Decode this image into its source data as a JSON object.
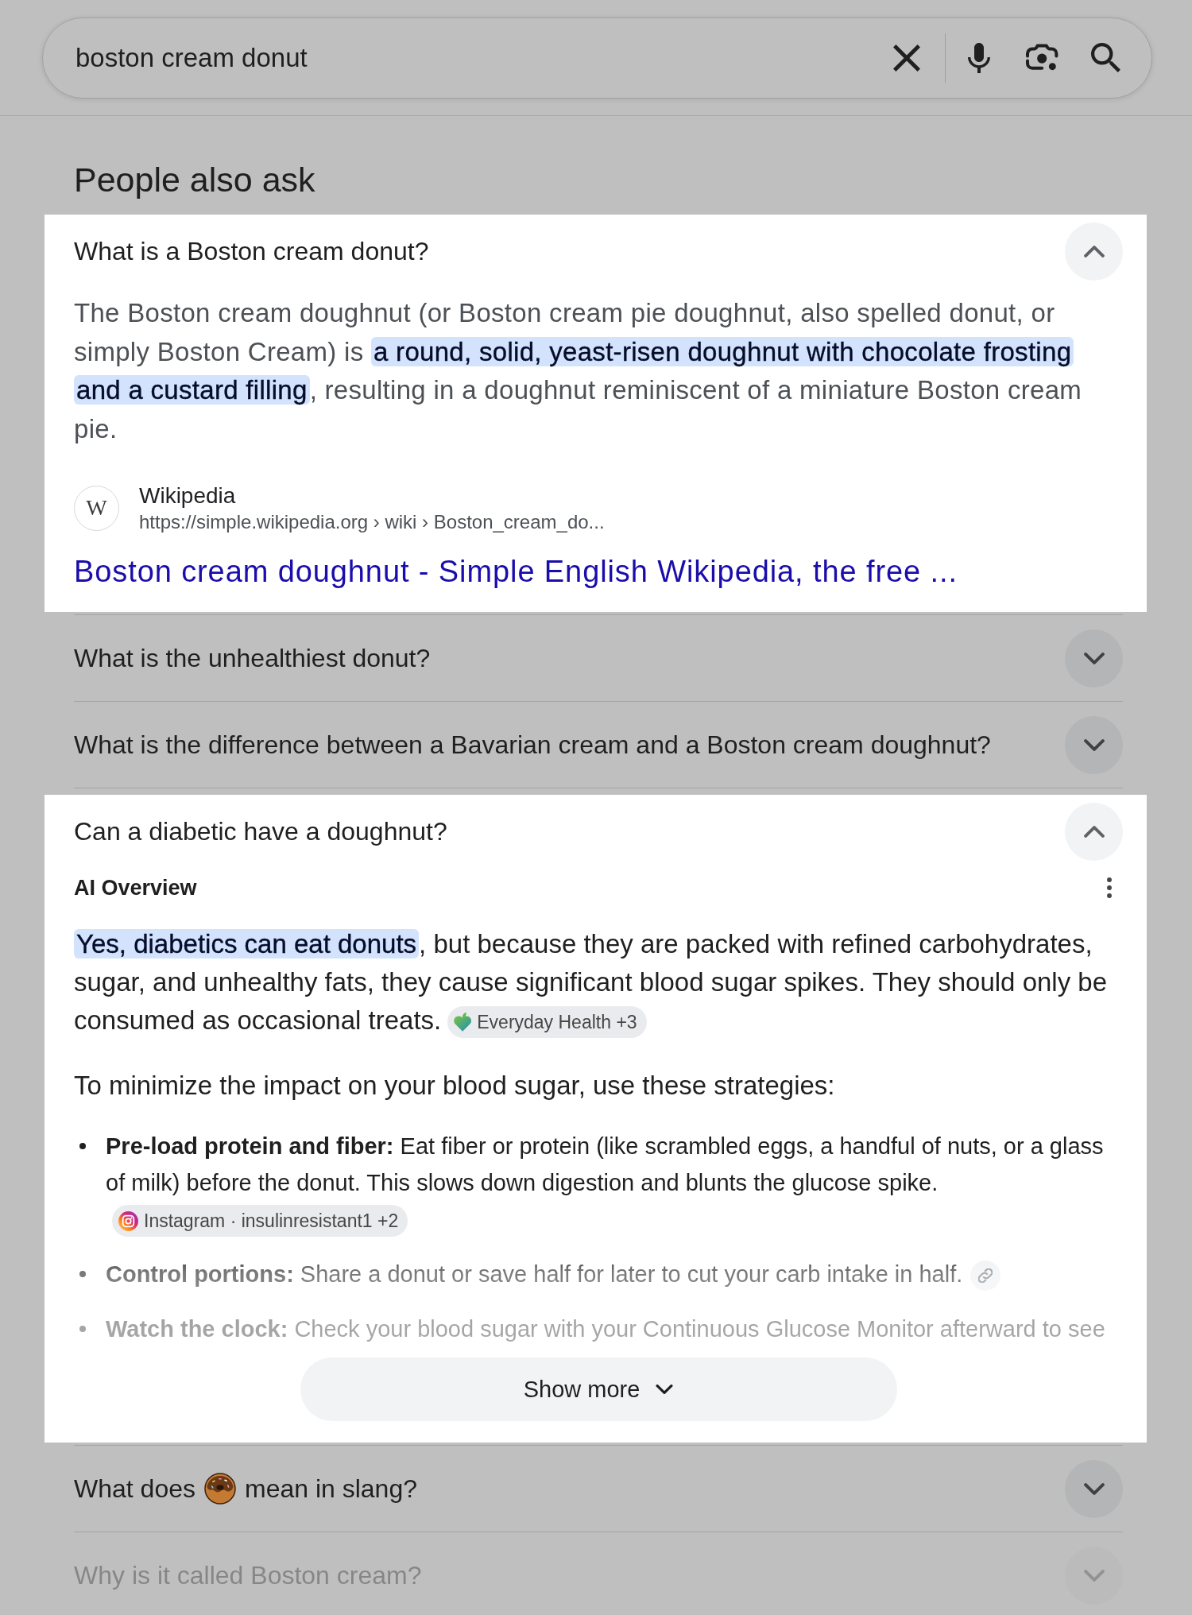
{
  "search": {
    "query": "boston cream donut"
  },
  "section_title": "People also ask",
  "questions": [
    {
      "question": "What is a Boston cream donut?",
      "expanded": true,
      "faded": false,
      "kind": "snippet",
      "answer": [
        {
          "text": "The Boston cream doughnut (or Boston cream pie doughnut, also spelled donut, or simply Boston Cream) is ",
          "highlighted": false
        },
        {
          "text": "a round, solid, yeast-risen doughnut with chocolate frosting and a custard filling",
          "highlighted": true
        },
        {
          "text": ", resulting in a doughnut reminiscent of a miniature Boston cream pie.",
          "highlighted": false
        }
      ],
      "source": {
        "logo_letter": "W",
        "name": "Wikipedia",
        "url": "https://simple.wikipedia.org › wiki › Boston_cream_do...",
        "title": "Boston cream doughnut - Simple English Wikipedia, the free ..."
      }
    },
    {
      "question": "What is the unhealthiest donut?",
      "expanded": false,
      "faded": false
    },
    {
      "question": "What is the difference between a Bavarian cream and a Boston cream doughnut?",
      "expanded": false,
      "faded": false
    },
    {
      "question": "Can a diabetic have a doughnut?",
      "expanded": true,
      "faded": false,
      "kind": "ai_overview",
      "overview": {
        "label": "AI Overview",
        "summary": [
          {
            "text": "Yes, diabetics can eat donuts",
            "highlighted": true
          },
          {
            "text": ", but because they are packed with refined carbohydrates, sugar, and unhealthy fats, they cause significant blood sugar spikes. They should only be consumed as occasional treats.",
            "highlighted": false
          }
        ],
        "summary_chip": {
          "label": "Everyday Health +3"
        },
        "intro": "To minimize the impact on your blood sugar, use these strategies:",
        "truncated": true,
        "bullets": [
          {
            "text": "**Pre-load protein and fiber:** Eat fiber or protein (like scrambled eggs, a handful of nuts, or a glass of milk) before the donut. This slows down digestion and blunts the glucose spike.",
            "chip": {
              "kind": "source",
              "label": "Instagram · insulinresistant1 +2"
            }
          },
          {
            "text": "**Control portions:** Share a donut or save half for later to cut your carb intake in half.",
            "chip": {
              "kind": "link"
            }
          },
          {
            "text": "**Watch the clock:** Check your blood sugar with your Continuous Glucose Monitor afterward to see"
          }
        ],
        "show_more": "Show more"
      }
    },
    {
      "question_parts": [
        "What does",
        "mean in slang?"
      ],
      "expanded": false,
      "faded": false
    },
    {
      "question": "Why is it called Boston cream?",
      "expanded": false,
      "faded": true
    }
  ]
}
